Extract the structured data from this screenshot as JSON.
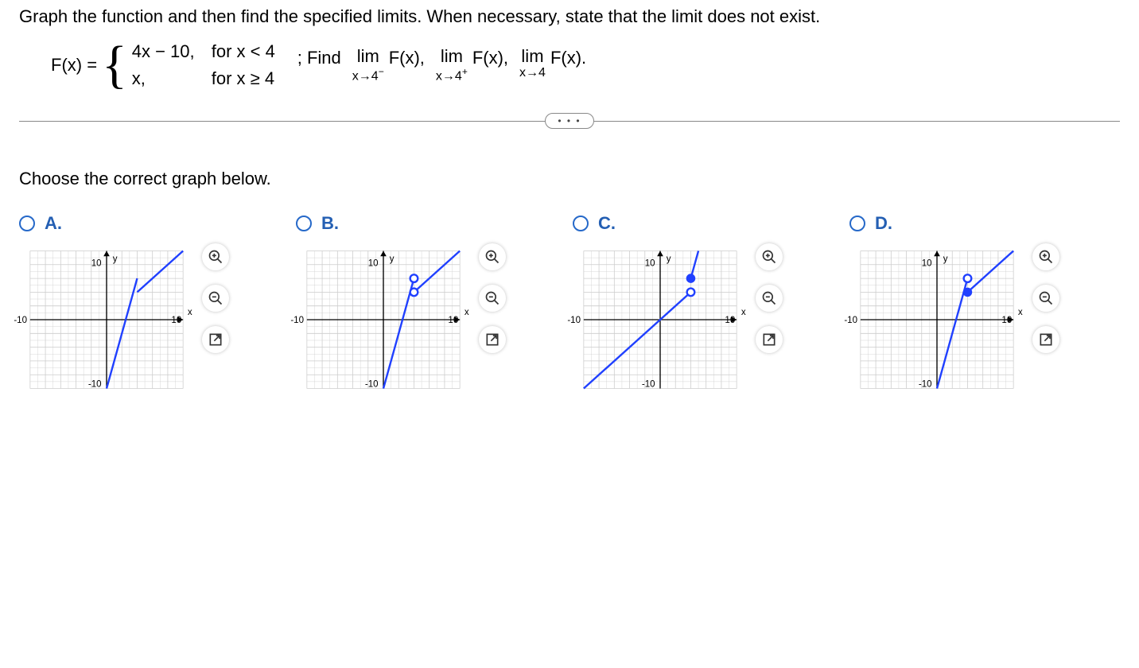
{
  "instruction": "Graph the function and then find the specified limits. When necessary, state that the limit does not exist.",
  "function_name": "F(x) =",
  "piece1_expr": "4x − 10,",
  "piece1_cond": "for x < 4",
  "piece2_expr": "x,",
  "piece2_cond": "for x ≥ 4",
  "find_prefix": "; Find",
  "lim_word": "lim",
  "fx_text": "F(x),",
  "fx_text_last": "F(x).",
  "sub1_a": "x→4",
  "sub1_sup": "−",
  "sub2_a": "x→4",
  "sub2_sup": "+",
  "sub3": "x→4",
  "ellipsis": "• • •",
  "choose_label": "Choose the correct graph below.",
  "options": [
    {
      "label": "A."
    },
    {
      "label": "B."
    },
    {
      "label": "C."
    },
    {
      "label": "D."
    }
  ],
  "axis": {
    "y": "y",
    "x": "x",
    "pos": "10",
    "negx": "-10",
    "negy": "-10"
  },
  "chart_data": [
    {
      "type": "line",
      "option": "A",
      "xlim": [
        -10,
        10
      ],
      "ylim": [
        -10,
        10
      ],
      "series": [
        {
          "name": "4x-10",
          "segment": [
            [
              0,
              -10
            ],
            [
              4,
              6
            ]
          ],
          "open_end": null,
          "closed_end": null
        },
        {
          "name": "x",
          "segment": [
            [
              4,
              4
            ],
            [
              10,
              10
            ]
          ],
          "open_end": null,
          "closed_end": null
        }
      ]
    },
    {
      "type": "line",
      "option": "B",
      "xlim": [
        -10,
        10
      ],
      "ylim": [
        -10,
        10
      ],
      "series": [
        {
          "name": "4x-10",
          "segment": [
            [
              0,
              -10
            ],
            [
              4,
              6
            ]
          ],
          "open_end": [
            4,
            6
          ],
          "closed_end": null
        },
        {
          "name": "x",
          "segment": [
            [
              4,
              4
            ],
            [
              10,
              10
            ]
          ],
          "open_end": [
            4,
            4
          ],
          "closed_end": null
        }
      ]
    },
    {
      "type": "line",
      "option": "C",
      "xlim": [
        -10,
        10
      ],
      "ylim": [
        -10,
        10
      ],
      "series": [
        {
          "name": "x",
          "segment": [
            [
              -10,
              -10
            ],
            [
              4,
              4
            ]
          ],
          "open_end": [
            4,
            4
          ],
          "closed_end": null
        },
        {
          "name": "closed-pt",
          "segment": null,
          "open_end": null,
          "closed_end": [
            4,
            6
          ]
        },
        {
          "name": "4x-10 up",
          "segment": [
            [
              4,
              6
            ],
            [
              5,
              10
            ]
          ],
          "open_end": null,
          "closed_end": null
        }
      ]
    },
    {
      "type": "line",
      "option": "D",
      "xlim": [
        -10,
        10
      ],
      "ylim": [
        -10,
        10
      ],
      "series": [
        {
          "name": "4x-10",
          "segment": [
            [
              0,
              -10
            ],
            [
              4,
              6
            ]
          ],
          "open_end": [
            4,
            6
          ],
          "closed_end": null
        },
        {
          "name": "x",
          "segment": [
            [
              4,
              4
            ],
            [
              10,
              10
            ]
          ],
          "open_end": null,
          "closed_end": [
            4,
            4
          ]
        }
      ]
    }
  ]
}
